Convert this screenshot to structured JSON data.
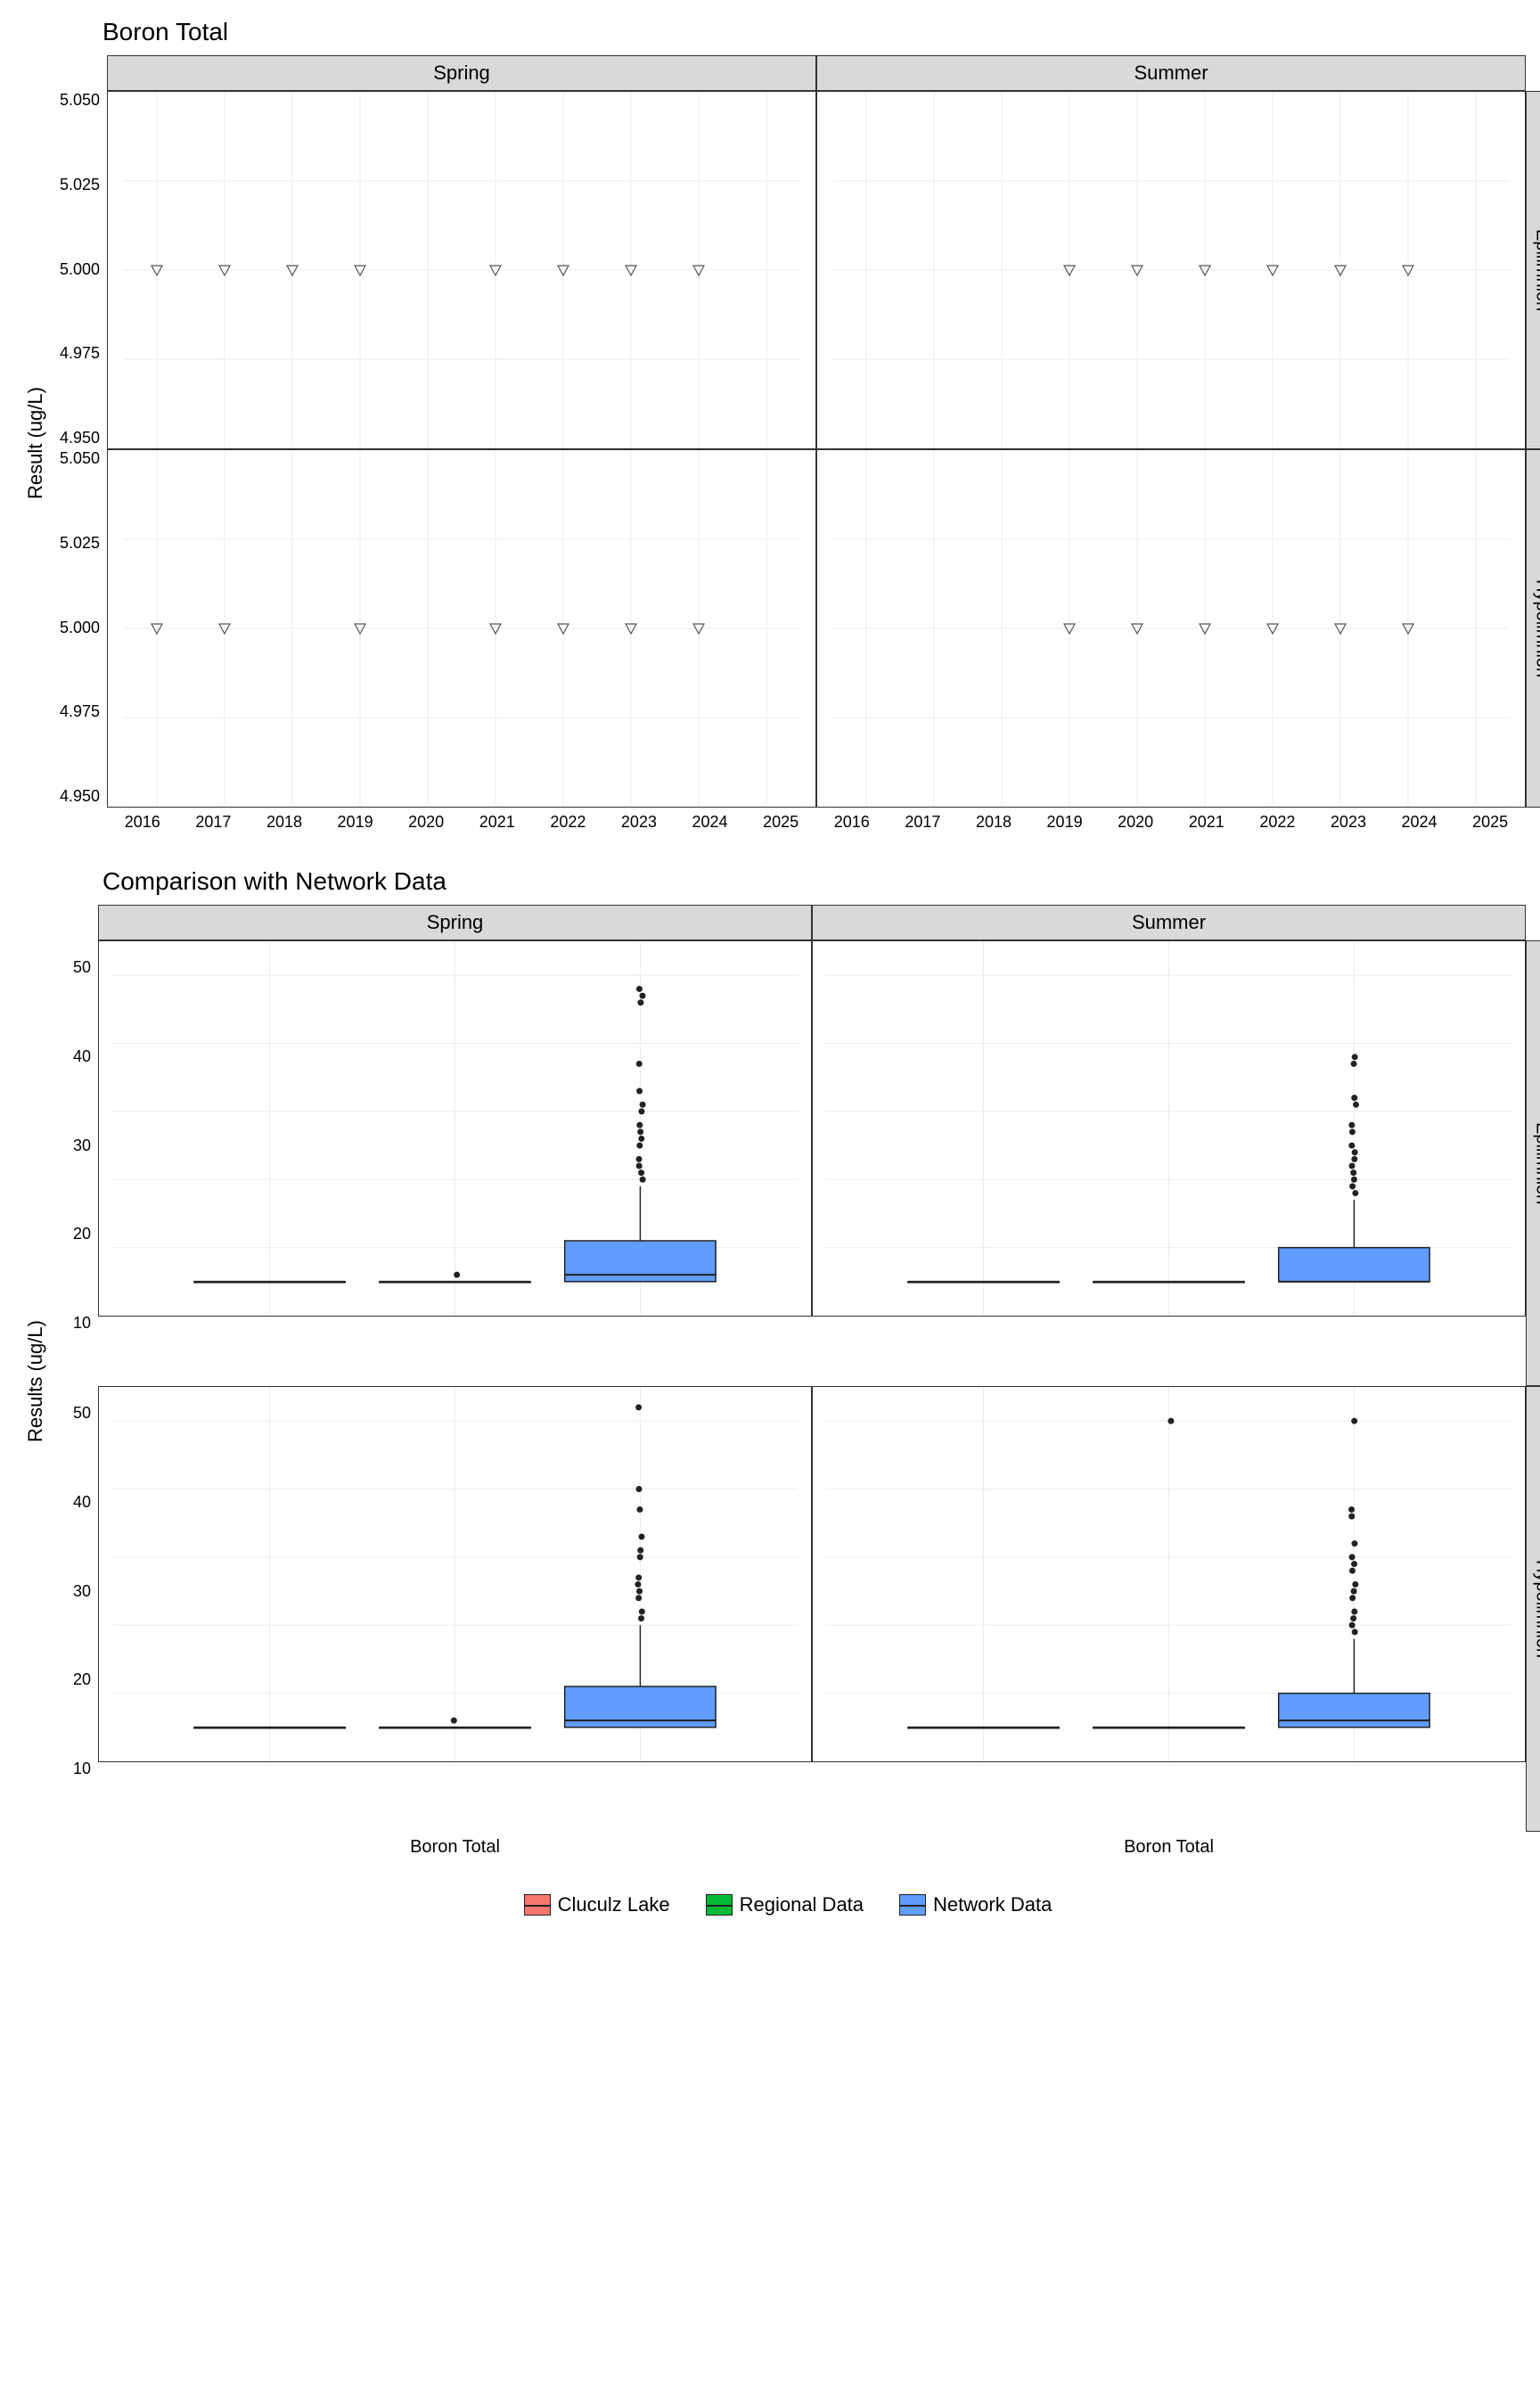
{
  "top_chart": {
    "title": "Boron Total",
    "ylabel": "Result (ug/L)",
    "col_facets": [
      "Spring",
      "Summer"
    ],
    "row_facets": [
      "Epilimnion",
      "Hypolimnion"
    ],
    "y_ticks": [
      "5.050",
      "5.025",
      "5.000",
      "4.975",
      "4.950"
    ],
    "x_ticks": [
      "2016",
      "2017",
      "2018",
      "2019",
      "2020",
      "2021",
      "2022",
      "2023",
      "2024",
      "2025"
    ]
  },
  "bottom_chart": {
    "title": "Comparison with Network Data",
    "ylabel": "Results (ug/L)",
    "col_facets": [
      "Spring",
      "Summer"
    ],
    "row_facets": [
      "Epilimnion",
      "Hypolimnion"
    ],
    "y_ticks": [
      "50",
      "40",
      "30",
      "20",
      "10"
    ],
    "x_category": "Boron Total"
  },
  "legend": {
    "items": [
      {
        "label": "Cluculz Lake",
        "color": "#f8766d"
      },
      {
        "label": "Regional Data",
        "color": "#00ba38"
      },
      {
        "label": "Network Data",
        "color": "#619cff"
      }
    ]
  },
  "chart_data": [
    {
      "type": "scatter",
      "title": "Boron Total",
      "ylabel": "Result (ug/L)",
      "ylim": [
        4.95,
        5.05
      ],
      "x_years": [
        2016,
        2017,
        2018,
        2019,
        2020,
        2021,
        2022,
        2023,
        2024,
        2025
      ],
      "facets": [
        {
          "col": "Spring",
          "row": "Epilimnion",
          "x": [
            2016,
            2017,
            2018,
            2019,
            2021,
            2022,
            2023,
            2024
          ],
          "y": [
            5.0,
            5.0,
            5.0,
            5.0,
            5.0,
            5.0,
            5.0,
            5.0
          ]
        },
        {
          "col": "Summer",
          "row": "Epilimnion",
          "x": [
            2019,
            2020,
            2021,
            2022,
            2023,
            2024
          ],
          "y": [
            5.0,
            5.0,
            5.0,
            5.0,
            5.0,
            5.0
          ]
        },
        {
          "col": "Spring",
          "row": "Hypolimnion",
          "x": [
            2016,
            2017,
            2019,
            2021,
            2022,
            2023,
            2024
          ],
          "y": [
            5.0,
            5.0,
            5.0,
            5.0,
            5.0,
            5.0,
            5.0
          ]
        },
        {
          "col": "Summer",
          "row": "Hypolimnion",
          "x": [
            2019,
            2020,
            2021,
            2022,
            2023,
            2024
          ],
          "y": [
            5.0,
            5.0,
            5.0,
            5.0,
            5.0,
            5.0
          ]
        }
      ]
    },
    {
      "type": "boxplot",
      "title": "Comparison with Network Data",
      "ylabel": "Results (ug/L)",
      "ylim": [
        0,
        55
      ],
      "categories": [
        "Boron Total"
      ],
      "series_names": [
        "Cluculz Lake",
        "Regional Data",
        "Network Data"
      ],
      "facets": [
        {
          "col": "Spring",
          "row": "Epilimnion",
          "series": [
            {
              "name": "Cluculz Lake",
              "min": 5,
              "q1": 5,
              "median": 5,
              "q3": 5,
              "max": 5,
              "outliers": []
            },
            {
              "name": "Regional Data",
              "min": 5,
              "q1": 5,
              "median": 5,
              "q3": 5,
              "max": 5,
              "outliers": [
                6
              ]
            },
            {
              "name": "Network Data",
              "min": 5,
              "q1": 5,
              "median": 6,
              "q3": 11,
              "max": 19,
              "outliers": [
                20,
                21,
                22,
                23,
                25,
                26,
                27,
                28,
                30,
                31,
                33,
                37,
                46,
                47,
                48
              ]
            }
          ]
        },
        {
          "col": "Summer",
          "row": "Epilimnion",
          "series": [
            {
              "name": "Cluculz Lake",
              "min": 5,
              "q1": 5,
              "median": 5,
              "q3": 5,
              "max": 5,
              "outliers": []
            },
            {
              "name": "Regional Data",
              "min": 5,
              "q1": 5,
              "median": 5,
              "q3": 5,
              "max": 5,
              "outliers": []
            },
            {
              "name": "Network Data",
              "min": 5,
              "q1": 5,
              "median": 5,
              "q3": 10,
              "max": 17,
              "outliers": [
                18,
                19,
                20,
                21,
                22,
                23,
                24,
                25,
                27,
                28,
                31,
                32,
                37,
                38
              ]
            }
          ]
        },
        {
          "col": "Spring",
          "row": "Hypolimnion",
          "series": [
            {
              "name": "Cluculz Lake",
              "min": 5,
              "q1": 5,
              "median": 5,
              "q3": 5,
              "max": 5,
              "outliers": []
            },
            {
              "name": "Regional Data",
              "min": 5,
              "q1": 5,
              "median": 5,
              "q3": 5,
              "max": 5,
              "outliers": [
                6
              ]
            },
            {
              "name": "Network Data",
              "min": 5,
              "q1": 5,
              "median": 6,
              "q3": 11,
              "max": 20,
              "outliers": [
                21,
                22,
                24,
                25,
                26,
                27,
                30,
                31,
                33,
                37,
                40,
                52
              ]
            }
          ]
        },
        {
          "col": "Summer",
          "row": "Hypolimnion",
          "series": [
            {
              "name": "Cluculz Lake",
              "min": 5,
              "q1": 5,
              "median": 5,
              "q3": 5,
              "max": 5,
              "outliers": []
            },
            {
              "name": "Regional Data",
              "min": 5,
              "q1": 5,
              "median": 5,
              "q3": 5,
              "max": 5,
              "outliers": [
                50
              ]
            },
            {
              "name": "Network Data",
              "min": 5,
              "q1": 5,
              "median": 6,
              "q3": 10,
              "max": 18,
              "outliers": [
                19,
                20,
                21,
                22,
                24,
                25,
                26,
                28,
                29,
                30,
                32,
                36,
                37,
                50
              ]
            }
          ]
        }
      ]
    }
  ]
}
